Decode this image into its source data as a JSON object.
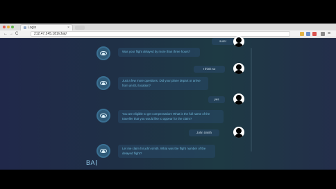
{
  "browser": {
    "tab_title": "Login",
    "tab_close": "×",
    "url": "212.47.245.181/chat/",
    "nav_back": "←",
    "nav_forward": "→",
    "nav_reload": "C",
    "menu": "≡"
  },
  "chat": {
    "messages": [
      {
        "sender": "user",
        "text": "sure!"
      },
      {
        "sender": "bot",
        "text": "Was your flight delayed by more than three hours?"
      },
      {
        "sender": "user",
        "text": "I think so"
      },
      {
        "sender": "bot",
        "text": "Just a few more questions. Did your plane depart or arrive from an EU location?"
      },
      {
        "sender": "user",
        "text": "yes"
      },
      {
        "sender": "bot",
        "text": "You are eligible to get compensation! What is the full name of the traveller that you would like to appear for the claim?"
      },
      {
        "sender": "user",
        "text": "John Smith"
      },
      {
        "sender": "bot",
        "text": "Let me claim for john smith. What was the flight number of the delayed flight?"
      }
    ],
    "brand": "BA"
  }
}
